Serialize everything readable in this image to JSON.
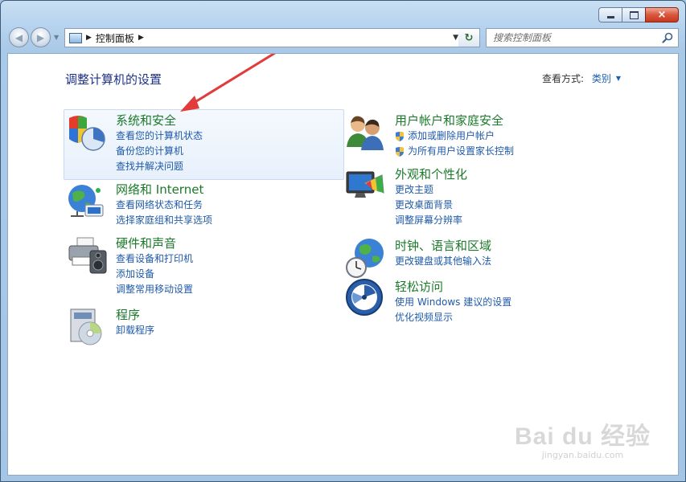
{
  "window": {
    "buttons": {
      "minimize": "",
      "maximize": "",
      "close": "×"
    }
  },
  "nav": {
    "back_glyph": "◀",
    "forward_glyph": "▶",
    "breadcrumb": "控制面板",
    "search_placeholder": "搜索控制面板"
  },
  "content": {
    "title": "调整计算机的设置",
    "view_by_label": "查看方式:",
    "view_by_value": "类别"
  },
  "categories": [
    {
      "title": "系统和安全",
      "links": [
        "查看您的计算机状态",
        "备份您的计算机",
        "查找并解决问题"
      ],
      "icon": "shield-pie-icon"
    },
    {
      "title": "网络和 Internet",
      "links": [
        "查看网络状态和任务",
        "选择家庭组和共享选项"
      ],
      "icon": "network-globe-icon"
    },
    {
      "title": "硬件和声音",
      "links": [
        "查看设备和打印机",
        "添加设备",
        "调整常用移动设置"
      ],
      "icon": "printer-speaker-icon"
    },
    {
      "title": "程序",
      "links": [
        "卸载程序"
      ],
      "icon": "programs-disc-icon"
    },
    {
      "title": "用户帐户和家庭安全",
      "links": [
        "添加或删除用户帐户",
        "为所有用户设置家长控制"
      ],
      "icon": "users-icon"
    },
    {
      "title": "外观和个性化",
      "links": [
        "更改主题",
        "更改桌面背景",
        "调整屏幕分辨率"
      ],
      "icon": "monitor-palette-icon"
    },
    {
      "title": "时钟、语言和区域",
      "links": [
        "更改键盘或其他输入法"
      ],
      "icon": "clock-globe-icon"
    },
    {
      "title": "轻松访问",
      "links": [
        "使用 Windows 建议的设置",
        "优化视频显示"
      ],
      "icon": "ease-access-icon"
    }
  ],
  "watermark": {
    "logo": "Bai du 经验",
    "url": "jingyan.baidu.com"
  },
  "colors": {
    "category_title": "#1b7a2a",
    "link": "#1f5aa8",
    "page_title": "#1e3287",
    "annotation_arrow": "#e23b3b"
  }
}
